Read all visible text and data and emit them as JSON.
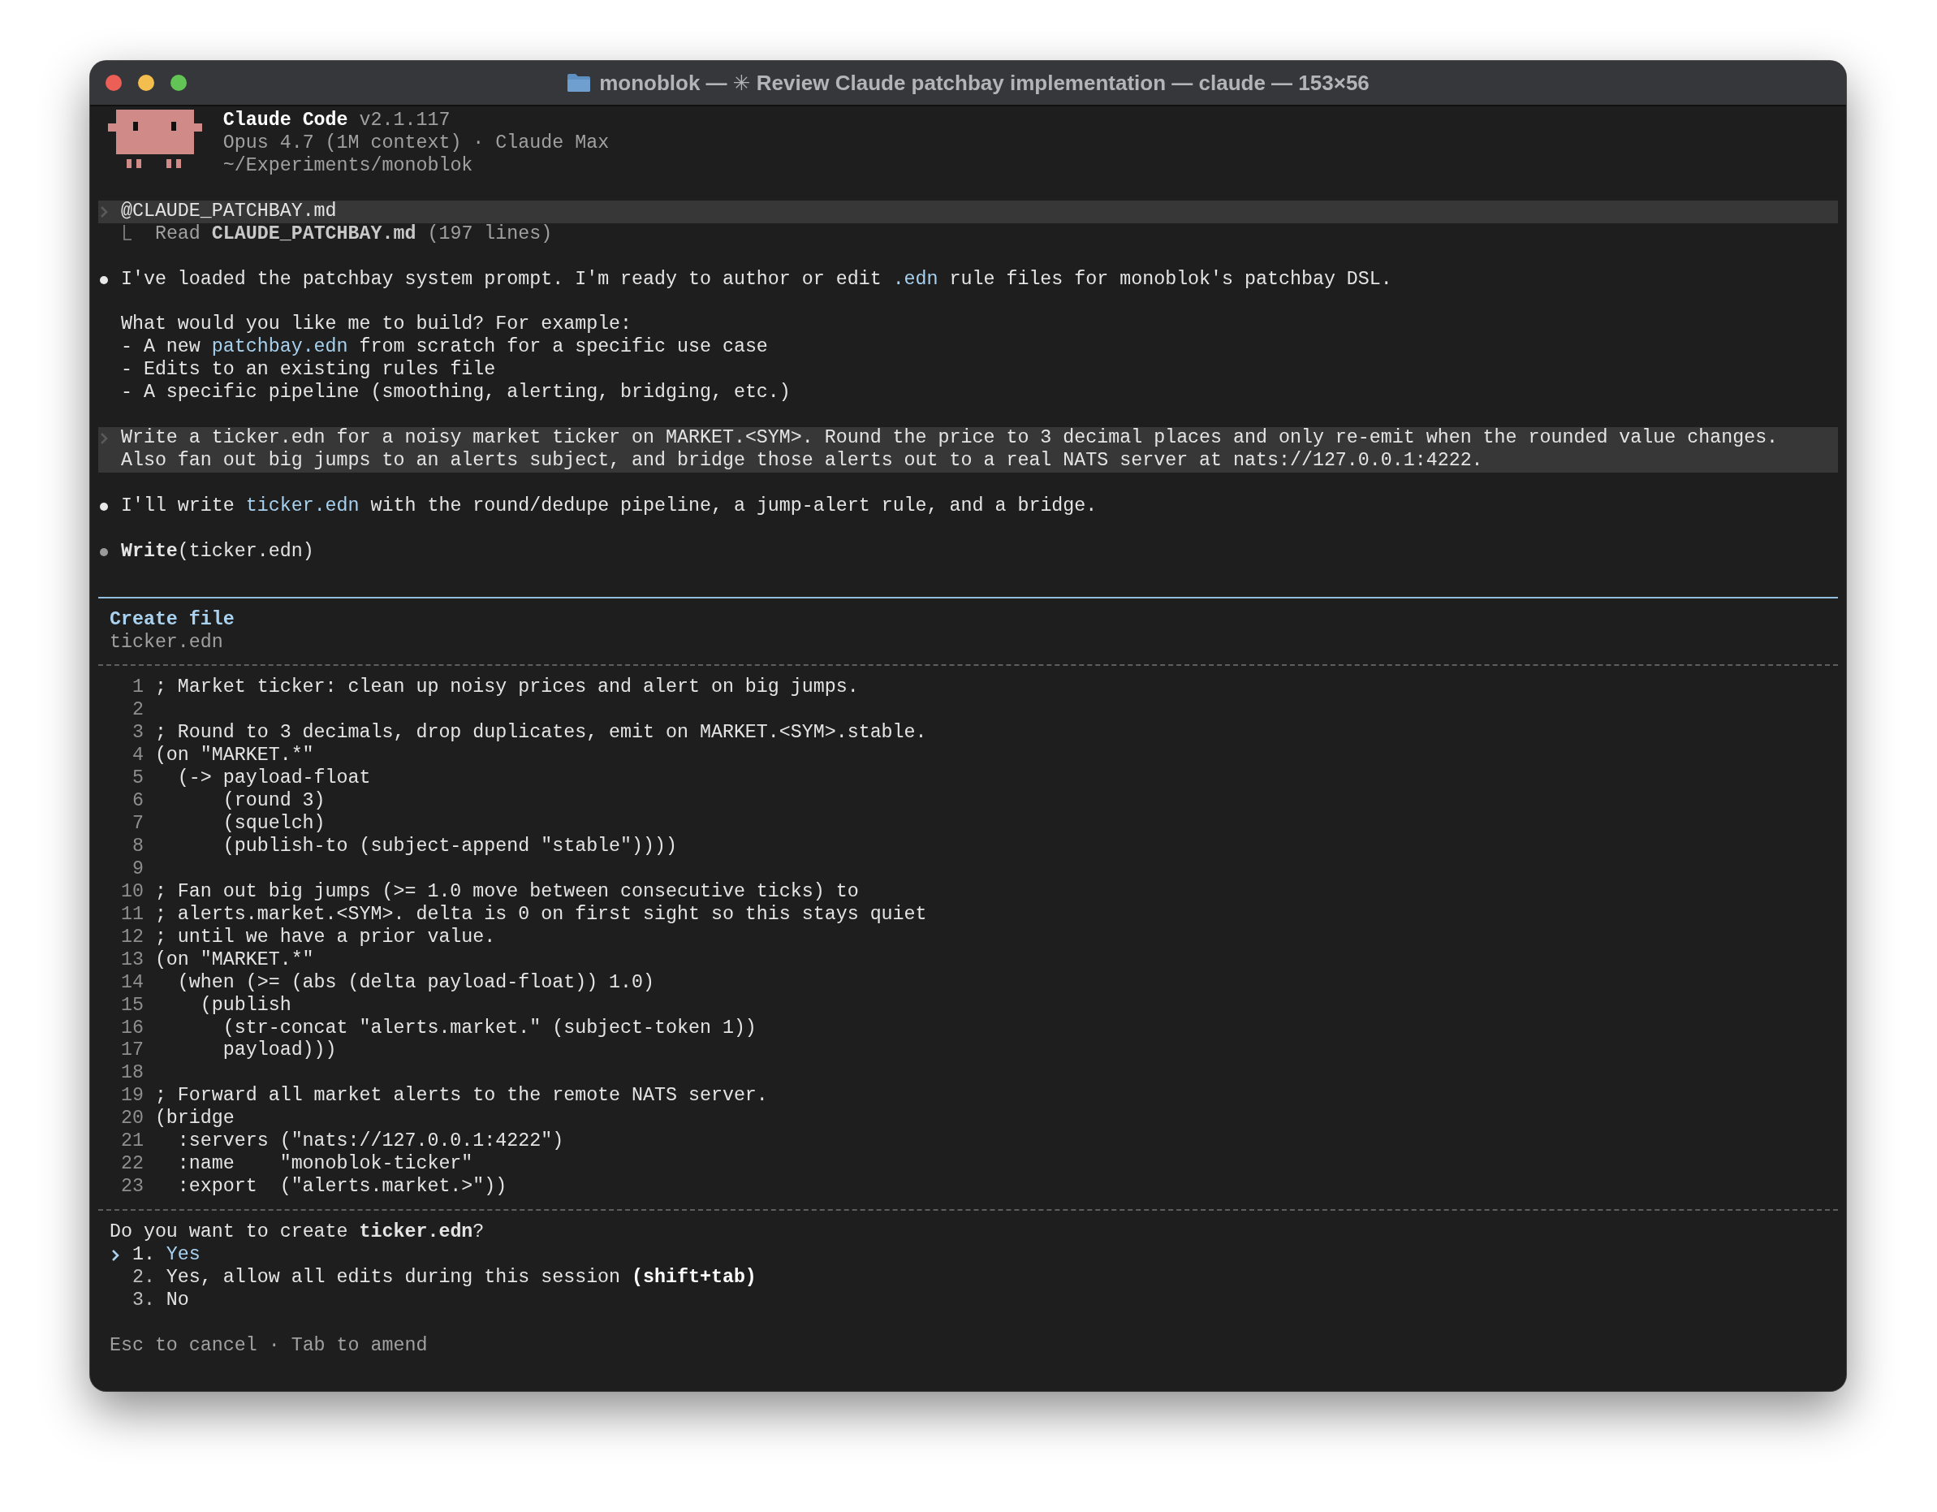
{
  "window": {
    "title": "monoblok — ✳ Review Claude patchbay implementation — claude — 153×56"
  },
  "banner": {
    "product": "Claude Code",
    "version": "v2.1.117",
    "model": "Opus 4.7 (1M context) · Claude Max",
    "cwd": "~/Experiments/monoblok"
  },
  "transcript": [
    {
      "kind": "user_prompt",
      "lines": [
        "@CLAUDE_PATCHBAY.md"
      ]
    },
    {
      "kind": "tool_result",
      "text": "Read **CLAUDE_PATCHBAY.md** (197 lines)"
    },
    {
      "kind": "assistant_message",
      "paragraphs": [
        [
          [
            "I've loaded the patchbay system prompt. I'm ready to author or edit ",
            {
              "kind": "code",
              "text": ".edn"
            },
            " rule files for monoblok's patchbay DSL."
          ]
        ],
        [
          [
            "What would you like me to build? For example:"
          ],
          [
            "- A new ",
            {
              "kind": "code",
              "text": "patchbay.edn"
            },
            " from scratch for a specific use case"
          ],
          [
            "- Edits to an existing rules file"
          ],
          [
            "- A specific pipeline (smoothing, alerting, bridging, etc.)"
          ]
        ]
      ]
    },
    {
      "kind": "user_prompt",
      "lines": [
        "Write a ticker.edn for a noisy market ticker on MARKET.<SYM>. Round the price to 3 decimal places and only re-emit when the rounded value changes.",
        "Also fan out big jumps to an alerts subject, and bridge those alerts out to a real NATS server at nats://127.0.0.1:4222."
      ]
    },
    {
      "kind": "assistant_message",
      "paragraphs": [
        [
          [
            "I'll write ",
            {
              "kind": "code",
              "text": "ticker.edn"
            },
            " with the round/dedupe pipeline, a jump-alert rule, and a bridge."
          ]
        ]
      ]
    },
    {
      "kind": "tool_call",
      "text": "**Write**(ticker.edn)"
    }
  ],
  "dialog": {
    "title": "Create file",
    "filename": "ticker.edn",
    "code_lines": [
      {
        "number": "1",
        "text": "; Market ticker: clean up noisy prices and alert on big jumps."
      },
      {
        "number": "2"
      },
      {
        "number": "3",
        "text": "; Round to 3 decimals, drop duplicates, emit on MARKET.<SYM>.stable."
      },
      {
        "number": "4",
        "text": "(on \"MARKET.*\""
      },
      {
        "number": "5",
        "text": "  (-> payload-float"
      },
      {
        "number": "6",
        "text": "      (round 3)"
      },
      {
        "number": "7",
        "text": "      (squelch)"
      },
      {
        "number": "8",
        "text": "      (publish-to (subject-append \"stable\"))))"
      },
      {
        "number": "9"
      },
      {
        "number": "10",
        "text": "; Fan out big jumps (>= 1.0 move between consecutive ticks) to"
      },
      {
        "number": "11",
        "text": "; alerts.market.<SYM>. delta is 0 on first sight so this stays quiet"
      },
      {
        "number": "12",
        "text": "; until we have a prior value."
      },
      {
        "number": "13",
        "text": "(on \"MARKET.*\""
      },
      {
        "number": "14",
        "text": "  (when (>= (abs (delta payload-float)) 1.0)"
      },
      {
        "number": "15",
        "text": "    (publish"
      },
      {
        "number": "16",
        "text": "      (str-concat \"alerts.market.\" (subject-token 1))"
      },
      {
        "number": "17",
        "text": "      payload)))"
      },
      {
        "number": "18"
      },
      {
        "number": "19",
        "text": "; Forward all market alerts to the remote NATS server."
      },
      {
        "number": "20",
        "text": "(bridge"
      },
      {
        "number": "21",
        "text": "  :servers (\"nats://127.0.0.1:4222\")"
      },
      {
        "number": "22",
        "text": "  :name    \"monoblok-ticker\""
      },
      {
        "number": "23",
        "text": "  :export  (\"alerts.market.>\"))"
      }
    ],
    "question": "Do you want to create **ticker.edn**?",
    "options": [
      {
        "number": "1.",
        "label": "Yes",
        "selected": true
      },
      {
        "number": "2.",
        "label": "Yes, allow all edits during this session **(shift+tab)**",
        "selected": false
      },
      {
        "number": "3.",
        "label": "No",
        "selected": false
      }
    ],
    "hint": "Esc to cancel · Tab to amend"
  }
}
